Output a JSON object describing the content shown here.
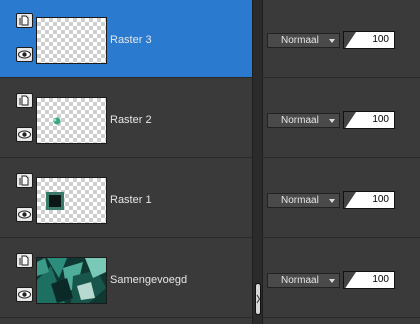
{
  "layers": [
    {
      "name": "Raster 3",
      "blend_mode": "Normaal",
      "opacity": "100",
      "opacity_value": 1.0,
      "selected": true
    },
    {
      "name": "Raster 2",
      "blend_mode": "Normaal",
      "opacity": "100",
      "opacity_value": 1.0,
      "selected": false
    },
    {
      "name": "Raster 1",
      "blend_mode": "Normaal",
      "opacity": "100",
      "opacity_value": 1.0,
      "selected": false
    },
    {
      "name": "Samengevoegd",
      "blend_mode": "Normaal",
      "opacity": "100",
      "opacity_value": 1.0,
      "selected": false
    }
  ],
  "icons": {
    "link": "link-icon",
    "visibility": "eye-icon",
    "dropdown": "chevron-down-icon",
    "splitter": "chevron-right-icon"
  },
  "colors": {
    "selected_row": "#2a7ad0",
    "panel_bg": "#3a3a3a",
    "thumb_green": "#2f9a7c"
  }
}
